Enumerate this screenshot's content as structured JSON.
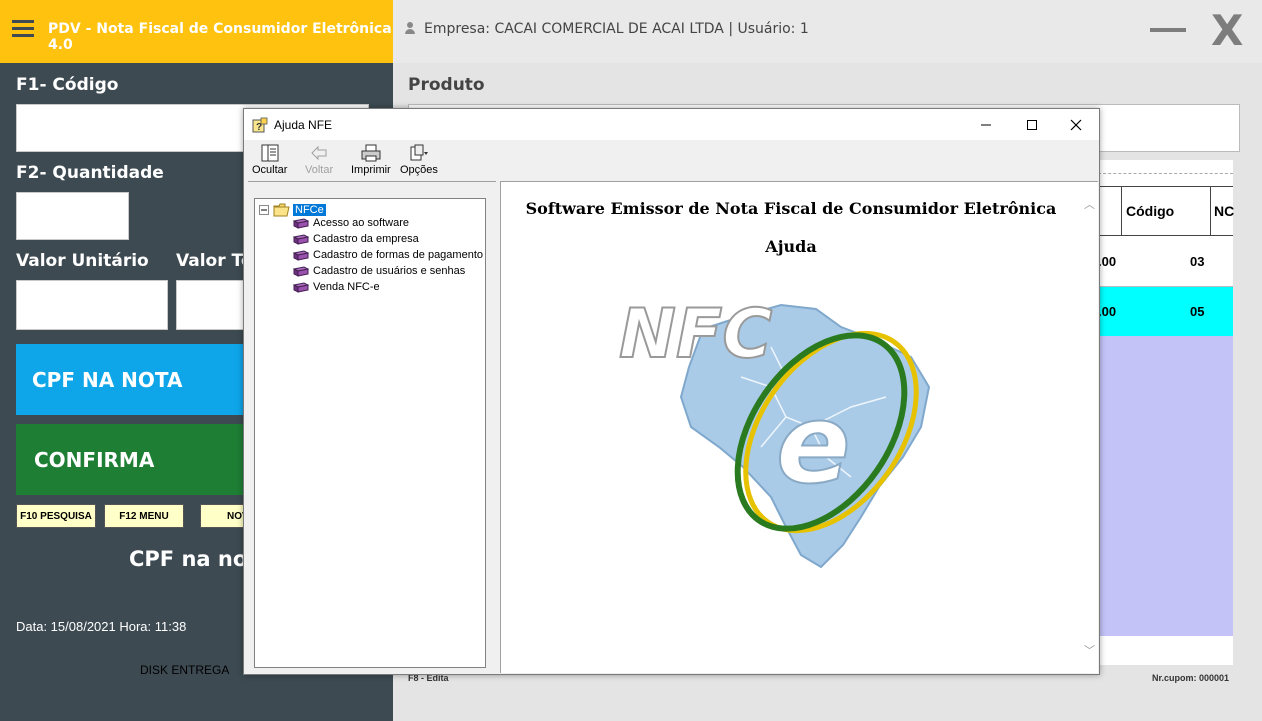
{
  "header": {
    "app_title": "PDV - Nota Fiscal de Consumidor Eletrônica 4.0",
    "company_info": "Empresa: CACAI COMERCIAL DE ACAI LTDA | Usuário: 1",
    "close_label": "X"
  },
  "form": {
    "codigo_label": "F1- Código",
    "quantidade_label": "F2- Quantidade",
    "valor_unitario_label": "Valor Unitário",
    "valor_total_label": "Valor Tot"
  },
  "buttons": {
    "cpf_na_nota": "CPF NA NOTA",
    "confirma": "CONFIRMA",
    "f10": "F10 PESQUISA",
    "f12": "F12 MENU",
    "nov": "NOV"
  },
  "status": {
    "cpf_text": "CPF na nota",
    "datetime": "Data: 15/08/2021  Hora: 11:38",
    "disk": "DISK ENTREGA",
    "f8": "F8 - Edita",
    "cupom": "Nr.cupom: 000001"
  },
  "produto": {
    "label": "Produto"
  },
  "grid": {
    "headers": [
      "Código",
      "NC"
    ],
    "rows": [
      {
        "value": ".00",
        "codigo": "03",
        "highlight": false
      },
      {
        "value": ".00",
        "codigo": "05",
        "highlight": true
      }
    ]
  },
  "help": {
    "title": "Ajuda NFE",
    "toolbar": {
      "ocultar": "Ocultar",
      "voltar": "Voltar",
      "imprimir": "Imprimir",
      "opcoes": "Opções"
    },
    "tree_root": "NFCe",
    "tree_items": [
      "Acesso ao software",
      "Cadastro da empresa",
      "Cadastro de formas de pagamento",
      "Cadastro de usuários e senhas",
      "Venda NFC-e"
    ],
    "heading": "Software Emissor de Nota Fiscal de Consumidor Eletrônica",
    "subheading": "Ajuda",
    "logo_text": "NFC",
    "logo_e": "e"
  },
  "colors": {
    "accent_yellow": "#ffc20e",
    "panel_dark": "#3d4a52",
    "cpf_blue": "#0ea5e9",
    "confirma_green": "#1e7e34",
    "highlight_cyan": "#00ffff",
    "lavender": "#c3c3f7"
  }
}
